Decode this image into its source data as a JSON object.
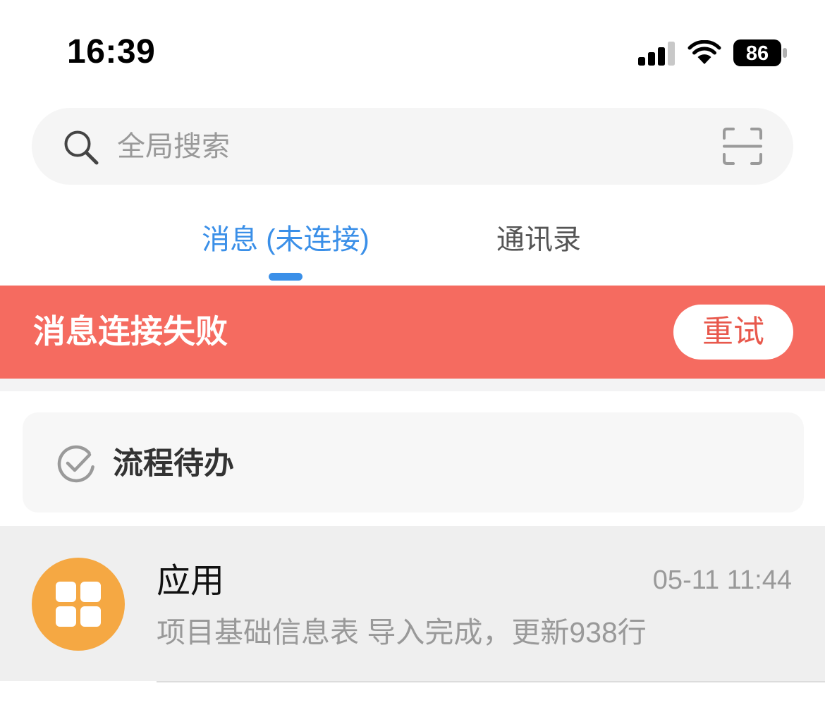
{
  "status_bar": {
    "time": "16:39",
    "battery": "86"
  },
  "search": {
    "placeholder": "全局搜索"
  },
  "tabs": [
    {
      "label": "消息 (未连接)",
      "active": true
    },
    {
      "label": "通讯录",
      "active": false
    }
  ],
  "banner": {
    "text": "消息连接失败",
    "retry_label": "重试"
  },
  "todo_card": {
    "label": "流程待办"
  },
  "conversations": [
    {
      "title": "应用",
      "time": "05-11 11:44",
      "preview": "项目基础信息表 导入完成，更新938行"
    }
  ],
  "colors": {
    "accent": "#3a8fe8",
    "banner": "#f56b60",
    "retry_text": "#e8584c",
    "avatar": "#f5a843",
    "muted_text": "#999999"
  },
  "icons": {
    "signal": "signal-icon",
    "wifi": "wifi-icon",
    "battery": "battery-icon",
    "search": "search-icon",
    "scan": "scan-icon",
    "todo": "check-circle-icon",
    "app": "app-grid-icon"
  }
}
